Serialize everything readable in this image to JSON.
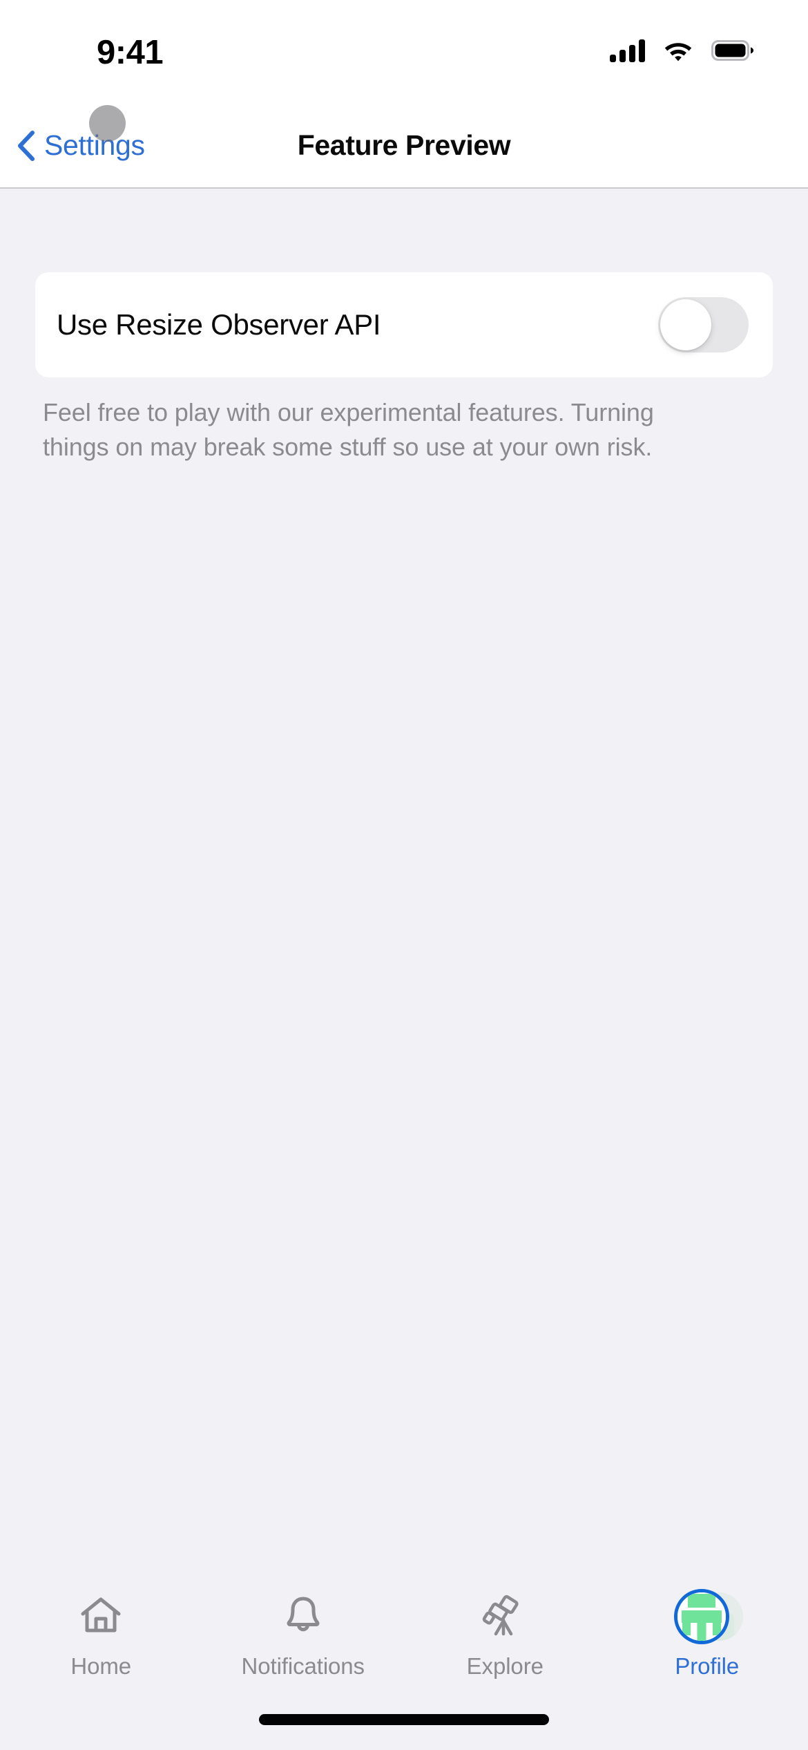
{
  "status_bar": {
    "time": "9:41",
    "cellular_icon": "cellular-signal-icon",
    "wifi_icon": "wifi-icon",
    "battery_icon": "battery-full-icon"
  },
  "nav_bar": {
    "back_icon": "chevron-left-icon",
    "back_label": "Settings",
    "title": "Feature Preview",
    "touch_indicator": "touch-indicator"
  },
  "settings": {
    "rows": [
      {
        "label": "Use Resize Observer API",
        "toggle_state": "off"
      }
    ],
    "footnote": "Feel free to play with our experimental features. Turning things on may break some stuff so use at your own risk."
  },
  "tab_bar": {
    "tabs": [
      {
        "label": "Home",
        "icon": "home-icon",
        "active": false
      },
      {
        "label": "Notifications",
        "icon": "bell-icon",
        "active": false
      },
      {
        "label": "Explore",
        "icon": "telescope-icon",
        "active": false
      },
      {
        "label": "Profile",
        "icon": "profile-avatar-icon",
        "active": true
      }
    ]
  },
  "colors": {
    "background": "#F2F1F6",
    "card": "#FFFFFF",
    "accent": "#2E6FD4",
    "accent_ring": "#1168D8",
    "text_primary": "#0B0B0C",
    "text_secondary": "#8A8A8F",
    "toggle_off_track": "#E6E6E8",
    "avatar_green": "#6FE39A"
  }
}
